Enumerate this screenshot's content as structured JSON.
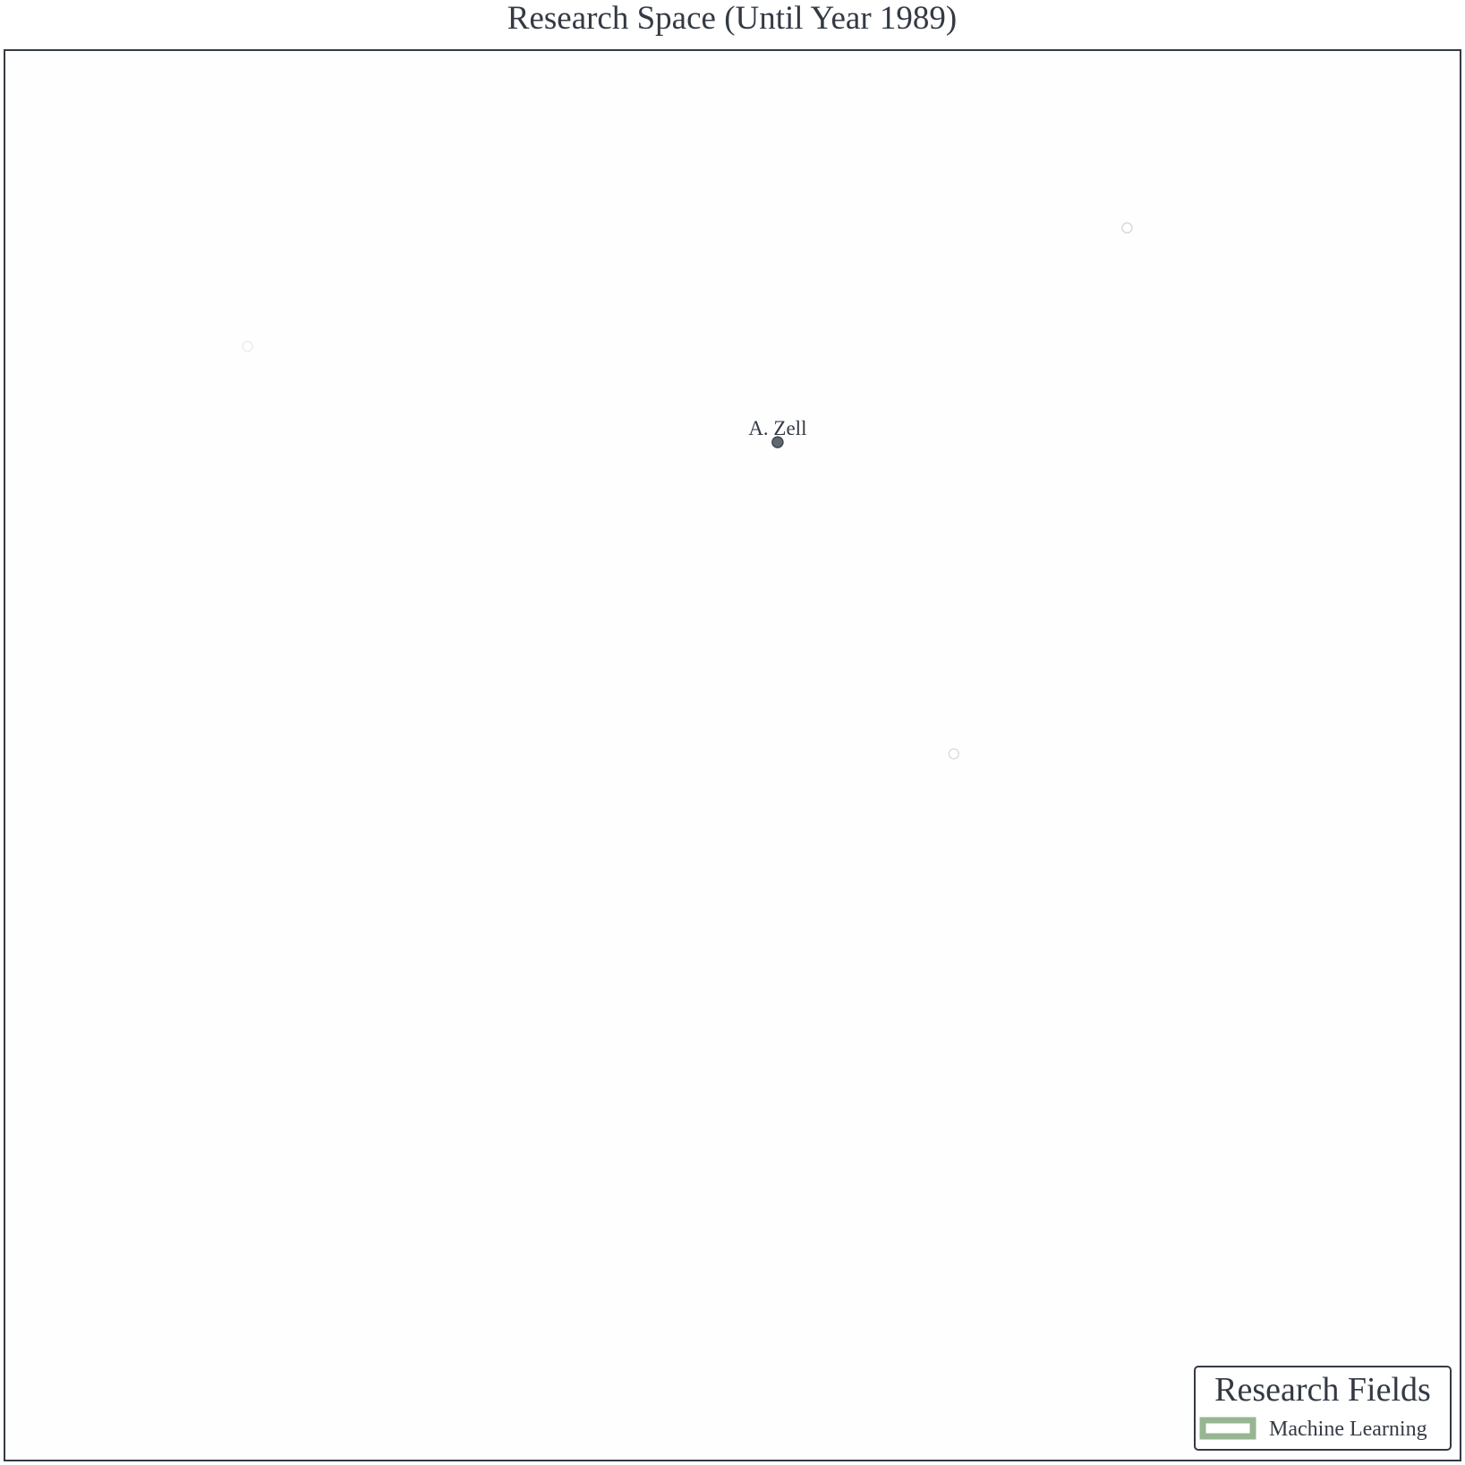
{
  "chart_data": {
    "type": "scatter",
    "title": "Research Space (Until Year 1989)",
    "xlabel": "",
    "ylabel": "",
    "grid": false,
    "legend": {
      "title": "Research Fields",
      "placement": "bottom-right",
      "entries": [
        {
          "label": "Machine Learning",
          "color": "#97b592"
        }
      ]
    },
    "xlim": [
      0,
      100
    ],
    "ylim": [
      0,
      100
    ],
    "points": [
      {
        "x": 53.1,
        "y": 72.2,
        "label": "A. Zell",
        "highlighted": true,
        "fill": "#5f6770",
        "stroke": "#404850"
      },
      {
        "x": 77.1,
        "y": 87.4,
        "label": "",
        "highlighted": false,
        "fill": "#ffffff",
        "stroke": "#d8d8d8"
      },
      {
        "x": 16.7,
        "y": 79.0,
        "label": "",
        "highlighted": false,
        "fill": "#ffffff",
        "stroke": "#ececec"
      },
      {
        "x": 65.2,
        "y": 50.1,
        "label": "",
        "highlighted": false,
        "fill": "#ffffff",
        "stroke": "#dcdcdc"
      }
    ],
    "colors": {
      "text": "#343a44",
      "frame": "#343a44",
      "background": "#fefefe"
    }
  }
}
